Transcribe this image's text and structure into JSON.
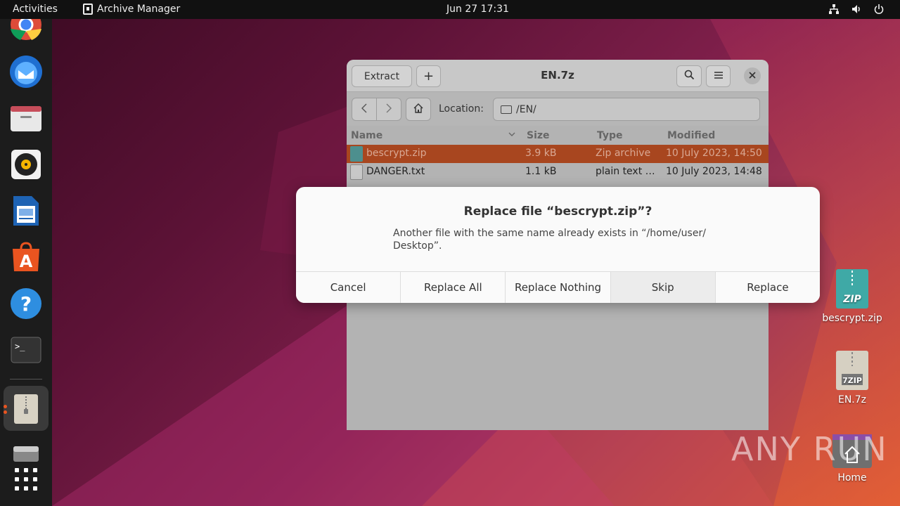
{
  "topbar": {
    "activities": "Activities",
    "app_name": "Archive Manager",
    "clock": "Jun 27  17:31"
  },
  "dock": {
    "items": [
      "chrome-icon",
      "thunderbird-icon",
      "files-icon",
      "rhythmbox-icon",
      "writer-icon",
      "app-center-icon",
      "help-icon",
      "terminal-icon",
      "archive-manager-icon",
      "disk-icon",
      "show-apps-icon"
    ]
  },
  "window": {
    "title": "EN.7z",
    "extract_label": "Extract",
    "add_label": "+",
    "location_label": "Location:",
    "location_value": "/EN/",
    "columns": {
      "name": "Name",
      "size": "Size",
      "type": "Type",
      "modified": "Modified"
    },
    "files": [
      {
        "name": "bescrypt.zip",
        "size": "3.9 kB",
        "type": "Zip archive",
        "modified": "10 July 2023, 14:50"
      },
      {
        "name": "DANGER.txt",
        "size": "1.1 kB",
        "type": "plain text …",
        "modified": "10 July 2023, 14:48"
      }
    ]
  },
  "dialog": {
    "title": "Replace file “bescrypt.zip”?",
    "message": "Another file with the same name already exists in “/home/user/ Desktop”.",
    "buttons": [
      "Cancel",
      "Replace All",
      "Replace Nothing",
      "Skip",
      "Replace"
    ]
  },
  "desktop": {
    "items": [
      {
        "label": "bescrypt.zip",
        "badge": "ZIP"
      },
      {
        "label": "EN.7z",
        "badge": "7ZIP"
      },
      {
        "label": "Home"
      }
    ]
  },
  "watermark": "ANY RUN",
  "colors": {
    "selection": "#a8461f",
    "accent": "#e95420"
  }
}
